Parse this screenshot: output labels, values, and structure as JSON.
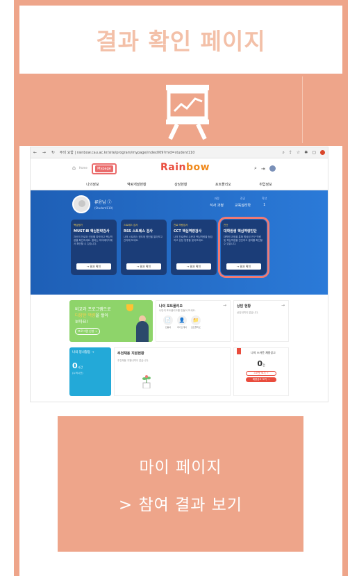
{
  "slide": {
    "title": "결과 확인 페이지",
    "cta_line1": "마이 페이지",
    "cta_line2": "> 참여 결과 보기",
    "accent_color": "#eea58a",
    "icon": "presentation-chart-icon"
  },
  "browser": {
    "url_bar": "주의 요함 | rainbow.cau.ac.kr/site/program/mypage/index009?mid=student110"
  },
  "site": {
    "home_label": "Home",
    "mypage_label": "Mypage",
    "logo_main": "Rain",
    "logo_tail": "bow",
    "menu": [
      "나의정보",
      "역량개발현황",
      "상담현황",
      "포트폴리오",
      "취업정보"
    ]
  },
  "profile": {
    "name": "류윤님 ⓘ",
    "id": "(Student110)",
    "stats": [
      {
        "label": "과정",
        "value": "석사 과정"
      },
      {
        "label": "전공",
        "value": "교육심리학"
      },
      {
        "label": "학년",
        "value": "1"
      }
    ]
  },
  "cards": [
    {
      "tag": "핵심평가",
      "title": "MUST-Ⅲ 핵심전략검사",
      "desc": "자신의 진로와 선호를 파악하고 핵심역량을 확인하세요. 결과는 마이페이지에서 확인할 수 있습니다.",
      "button": "→ 결과 확인"
    },
    {
      "tag": "스트레스 검사",
      "title": "RSS 스트레스 검사",
      "desc": "나의 스트레스 정도와 원인을 알아보고 관리해 보세요.",
      "button": "→ 결과 확인"
    },
    {
      "tag": "진로 역량검사",
      "title": "CCT 핵심역량검사",
      "desc": "나의 진로준비 수준과 핵심역량을 점검하고 성장 방향을 찾아보세요.",
      "button": "→ 결과 확인"
    },
    {
      "tag": "진단",
      "title": "대학원생 핵심역량진단",
      "desc": "대학원 과정을 통해 향상된 연구 역량 및 핵심역량을 진단하고 결과를 확인할 수 있습니다.",
      "button": "→ 결과 확인"
    }
  ],
  "banner": {
    "line1": "비교과 프로그램으로",
    "line2_highlight": "다양한 역량",
    "line2_tail": "을 쌓아",
    "line3": "보아요!",
    "button": "프로그램 신청 →"
  },
  "portfolio": {
    "title": "나의 포트폴리오",
    "subtitle": "나만의 포트폴리오를 만들어 보세요.",
    "arrow": "→",
    "items": [
      "인증서",
      "자기소개서",
      "포트폴리오"
    ]
  },
  "consult": {
    "title": "상담 현황",
    "empty": "상담내역이 없습니다.",
    "arrow": "→"
  },
  "activity": {
    "title": "나의 봉사활동 →",
    "count": "0",
    "unit": "시간",
    "sub": "(누적시간)"
  },
  "recommend": {
    "title": "추천채용 지원현황",
    "empty": "추천채용 지원내역이 없습니다."
  },
  "apply": {
    "title": "나의 스카웃 채용공고",
    "count": "0",
    "unit": "건",
    "btn1": "스카웃 보기 →",
    "btn2": "채용공고 보기 →"
  }
}
